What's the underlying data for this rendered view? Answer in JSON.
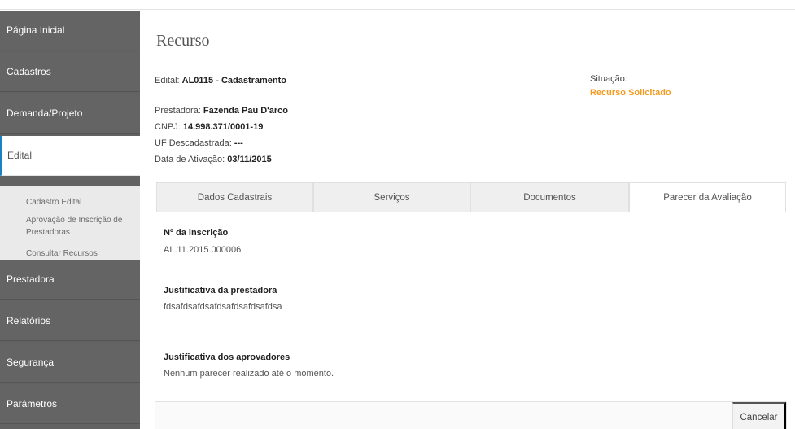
{
  "sidebar": {
    "items": [
      {
        "label": "Página Inicial"
      },
      {
        "label": "Cadastros"
      },
      {
        "label": "Demanda/Projeto"
      },
      {
        "label": "Edital"
      },
      {
        "label": "Prestadora"
      },
      {
        "label": "Relatórios"
      },
      {
        "label": "Segurança"
      },
      {
        "label": "Parâmetros"
      }
    ],
    "submenu": [
      {
        "label": "Cadastro Edital"
      },
      {
        "label": "Aprovação de Inscrição de Prestadoras"
      },
      {
        "label": "Consultar Recursos"
      }
    ]
  },
  "page": {
    "title": "Recurso"
  },
  "info": {
    "edital_label": "Edital: ",
    "edital_value": "AL0115 - Cadastramento",
    "prestadora_label": "Prestadora: ",
    "prestadora_value": "Fazenda Pau D'arco",
    "cnpj_label": "CNPJ: ",
    "cnpj_value": "14.998.371/0001-19",
    "uf_label": "UF Descadastrada: ",
    "uf_value": "---",
    "ativacao_label": "Data de Ativação: ",
    "ativacao_value": "03/11/2015",
    "situacao_label": "Situação:",
    "situacao_value": "Recurso Solicitado"
  },
  "tabs": [
    {
      "label": "Dados Cadastrais"
    },
    {
      "label": "Serviços"
    },
    {
      "label": "Documentos"
    },
    {
      "label": "Parecer da Avaliação"
    }
  ],
  "content": {
    "inscricao_label": "Nº da inscrição",
    "inscricao_value": "AL.11.2015.000006",
    "just_prestadora_label": "Justificativa da prestadora",
    "just_prestadora_value": "fdsafdsafdsafdsafdsafdsafdsa",
    "just_aprovadores_label": "Justificativa dos aprovadores",
    "just_aprovadores_value": "Nenhum parecer realizado até o momento."
  },
  "footer": {
    "cancel_label": "Cancelar"
  },
  "colors": {
    "sidebar_bg": "#646464",
    "active_accent": "#1f7fc4",
    "status_orange": "#f39a1e"
  }
}
